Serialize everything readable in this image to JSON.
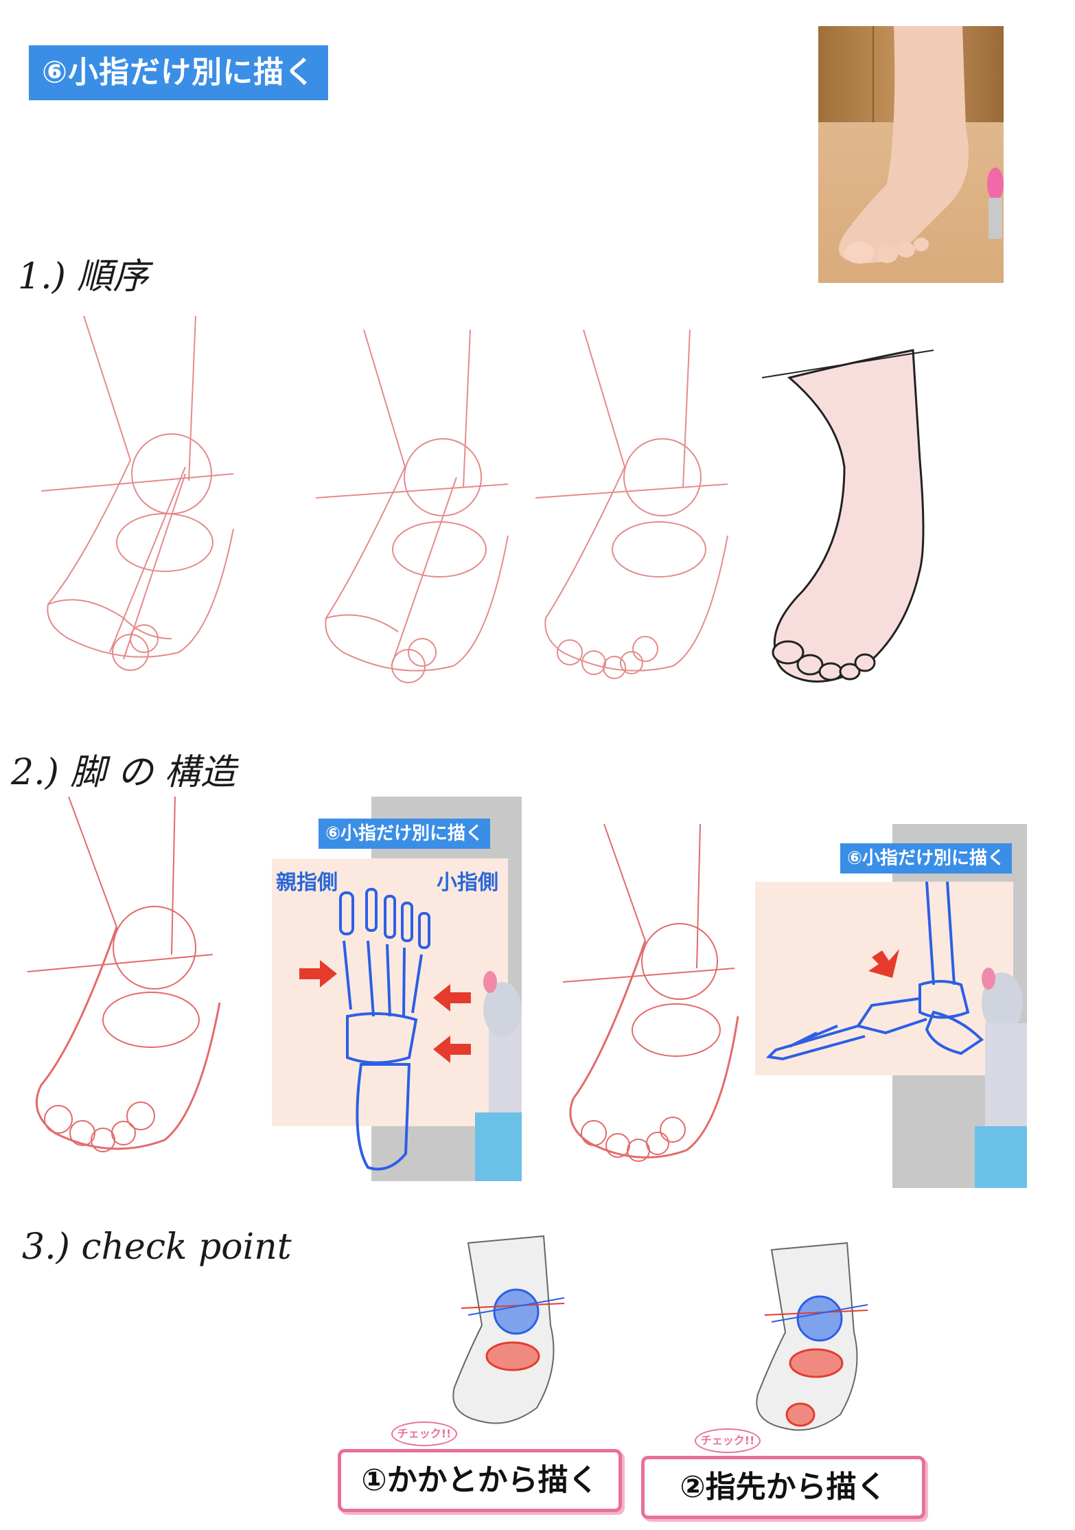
{
  "header": {
    "title": "⑥小指だけ別に描く"
  },
  "sections": [
    {
      "label": "1.) 順序"
    },
    {
      "label": "2.) 脚 の 構造"
    },
    {
      "label": "3.) check  point"
    }
  ],
  "anatomy": {
    "top_label": "⑥小指だけ別に描く",
    "big_toe_side": "親指側",
    "little_toe_side": "小指側",
    "side_label": "⑥小指だけ別に描く"
  },
  "checkpoints": [
    {
      "tag": "チェック!!",
      "text": "①かかとから描く"
    },
    {
      "tag": "チェック!!",
      "text": "②指先から描く"
    }
  ],
  "colors": {
    "sketch": "#e36a6a",
    "accent": "#3b8ee6",
    "bone": "#2c5fe6",
    "arrow": "#e53b2d",
    "pink": "#e8709c"
  }
}
